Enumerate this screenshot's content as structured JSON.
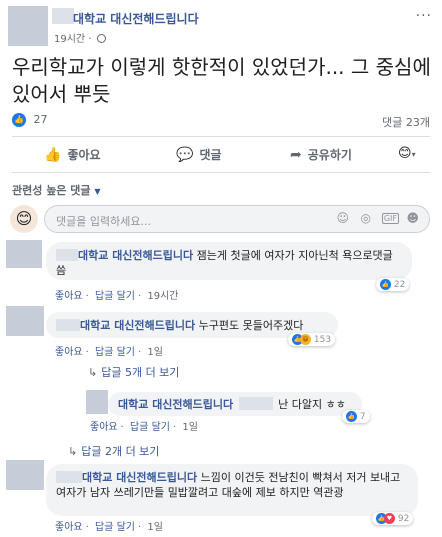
{
  "post": {
    "page_name": "대학교 대신전해드립니다",
    "time": "19시간",
    "text": "우리학교가 이렇게 핫한적이 있었던가... 그 중심에있어서 뿌듯",
    "reaction_count": "27",
    "comment_count": "댓글 23개"
  },
  "actions": {
    "like": "좋아요",
    "comment": "댓글",
    "share": "공유하기"
  },
  "sort": {
    "label": "관련성 높은 댓글"
  },
  "composer": {
    "placeholder": "댓글을 입력하세요...",
    "gif_label": "GIF"
  },
  "comments": [
    {
      "name": "대학교 대신전해드립니다",
      "text": "잼는게 첫글에 여자가 지아닌척 욕으로댓글씀",
      "like": "좋아요",
      "reply": "답글 달기",
      "time": "19시간",
      "reactions": "22"
    },
    {
      "name": "대학교 대신전해드립니다",
      "text": "누구편도 못들어주겠다",
      "like": "좋아요",
      "reply": "답글 달기",
      "time": "1일",
      "reactions": "153",
      "more_replies": "답글 5개 더 보기"
    },
    {
      "name": "대학교 대신전해드립니다",
      "text": "난 다알지 ㅎㅎ",
      "like": "좋아요",
      "reply": "답글 달기",
      "time": "1일",
      "reactions": "7",
      "more_replies": "답글 2개 더 보기"
    },
    {
      "name": "대학교 대신전해드립니다",
      "text": "느낌이 이건듯 전남친이 빡쳐서 저거 보내고 여자가 남자 쓰레기만들 밀밥깔려고 대숲에 제보 하지만 역관광",
      "like": "좋아요",
      "reply": "답글 달기",
      "time": "1일",
      "reactions": "92"
    }
  ],
  "colors": {
    "link": "#385898",
    "like_blue": "#1877f2",
    "bubble": "#f2f3f5",
    "divider": "#dadde1"
  },
  "icons": {
    "like": "thumbs-up-icon",
    "comment": "speech-bubble-icon",
    "share": "share-arrow-icon",
    "globe": "globe-icon",
    "emoji": "smiley-icon",
    "camera": "camera-icon",
    "sticker": "sticker-icon"
  }
}
